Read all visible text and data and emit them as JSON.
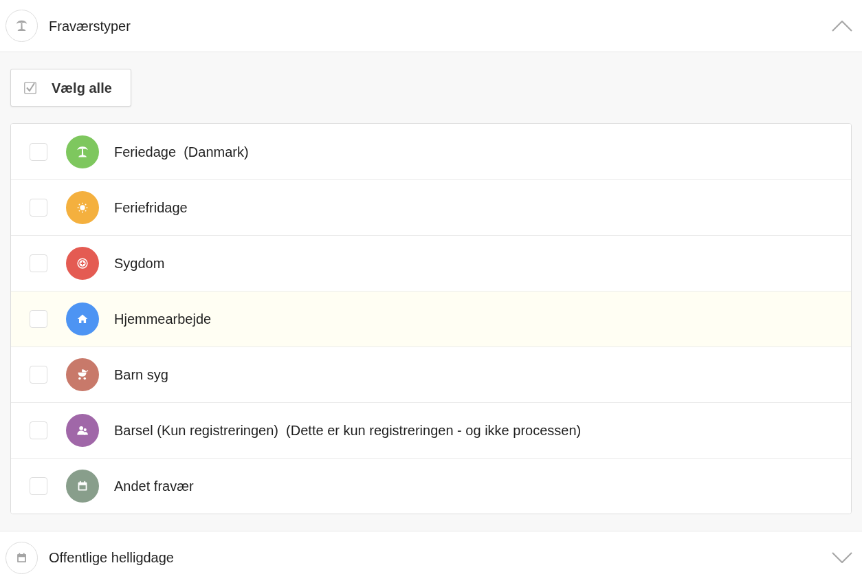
{
  "sections": [
    {
      "title": "Fraværstyper",
      "kind": "vacation",
      "expanded": true,
      "select_all": {
        "label": "Vælg alle"
      },
      "items": [
        {
          "label": "Feriedage  (Danmark)",
          "kind": "vacation",
          "color": "#7ec75e",
          "checked": false,
          "highlighted": false
        },
        {
          "label": "Feriefridage",
          "kind": "sun",
          "color": "#f4b03e",
          "checked": false,
          "highlighted": false
        },
        {
          "label": "Sygdom",
          "kind": "sick",
          "color": "#e45b52",
          "checked": false,
          "highlighted": false
        },
        {
          "label": "Hjemmearbejde",
          "kind": "home",
          "color": "#4d94f3",
          "checked": false,
          "highlighted": true
        },
        {
          "label": "Barn syg",
          "kind": "child",
          "color": "#c8796a",
          "checked": false,
          "highlighted": false
        },
        {
          "label": "Barsel (Kun registreringen)  (Dette er kun registreringen - og ikke processen)",
          "kind": "parental",
          "color": "#a067a8",
          "checked": false,
          "highlighted": false
        },
        {
          "label": "Andet fravær",
          "kind": "other",
          "color": "#889e8b",
          "checked": false,
          "highlighted": false
        }
      ]
    },
    {
      "title": "Offentlige helligdage",
      "kind": "other",
      "expanded": false
    }
  ]
}
